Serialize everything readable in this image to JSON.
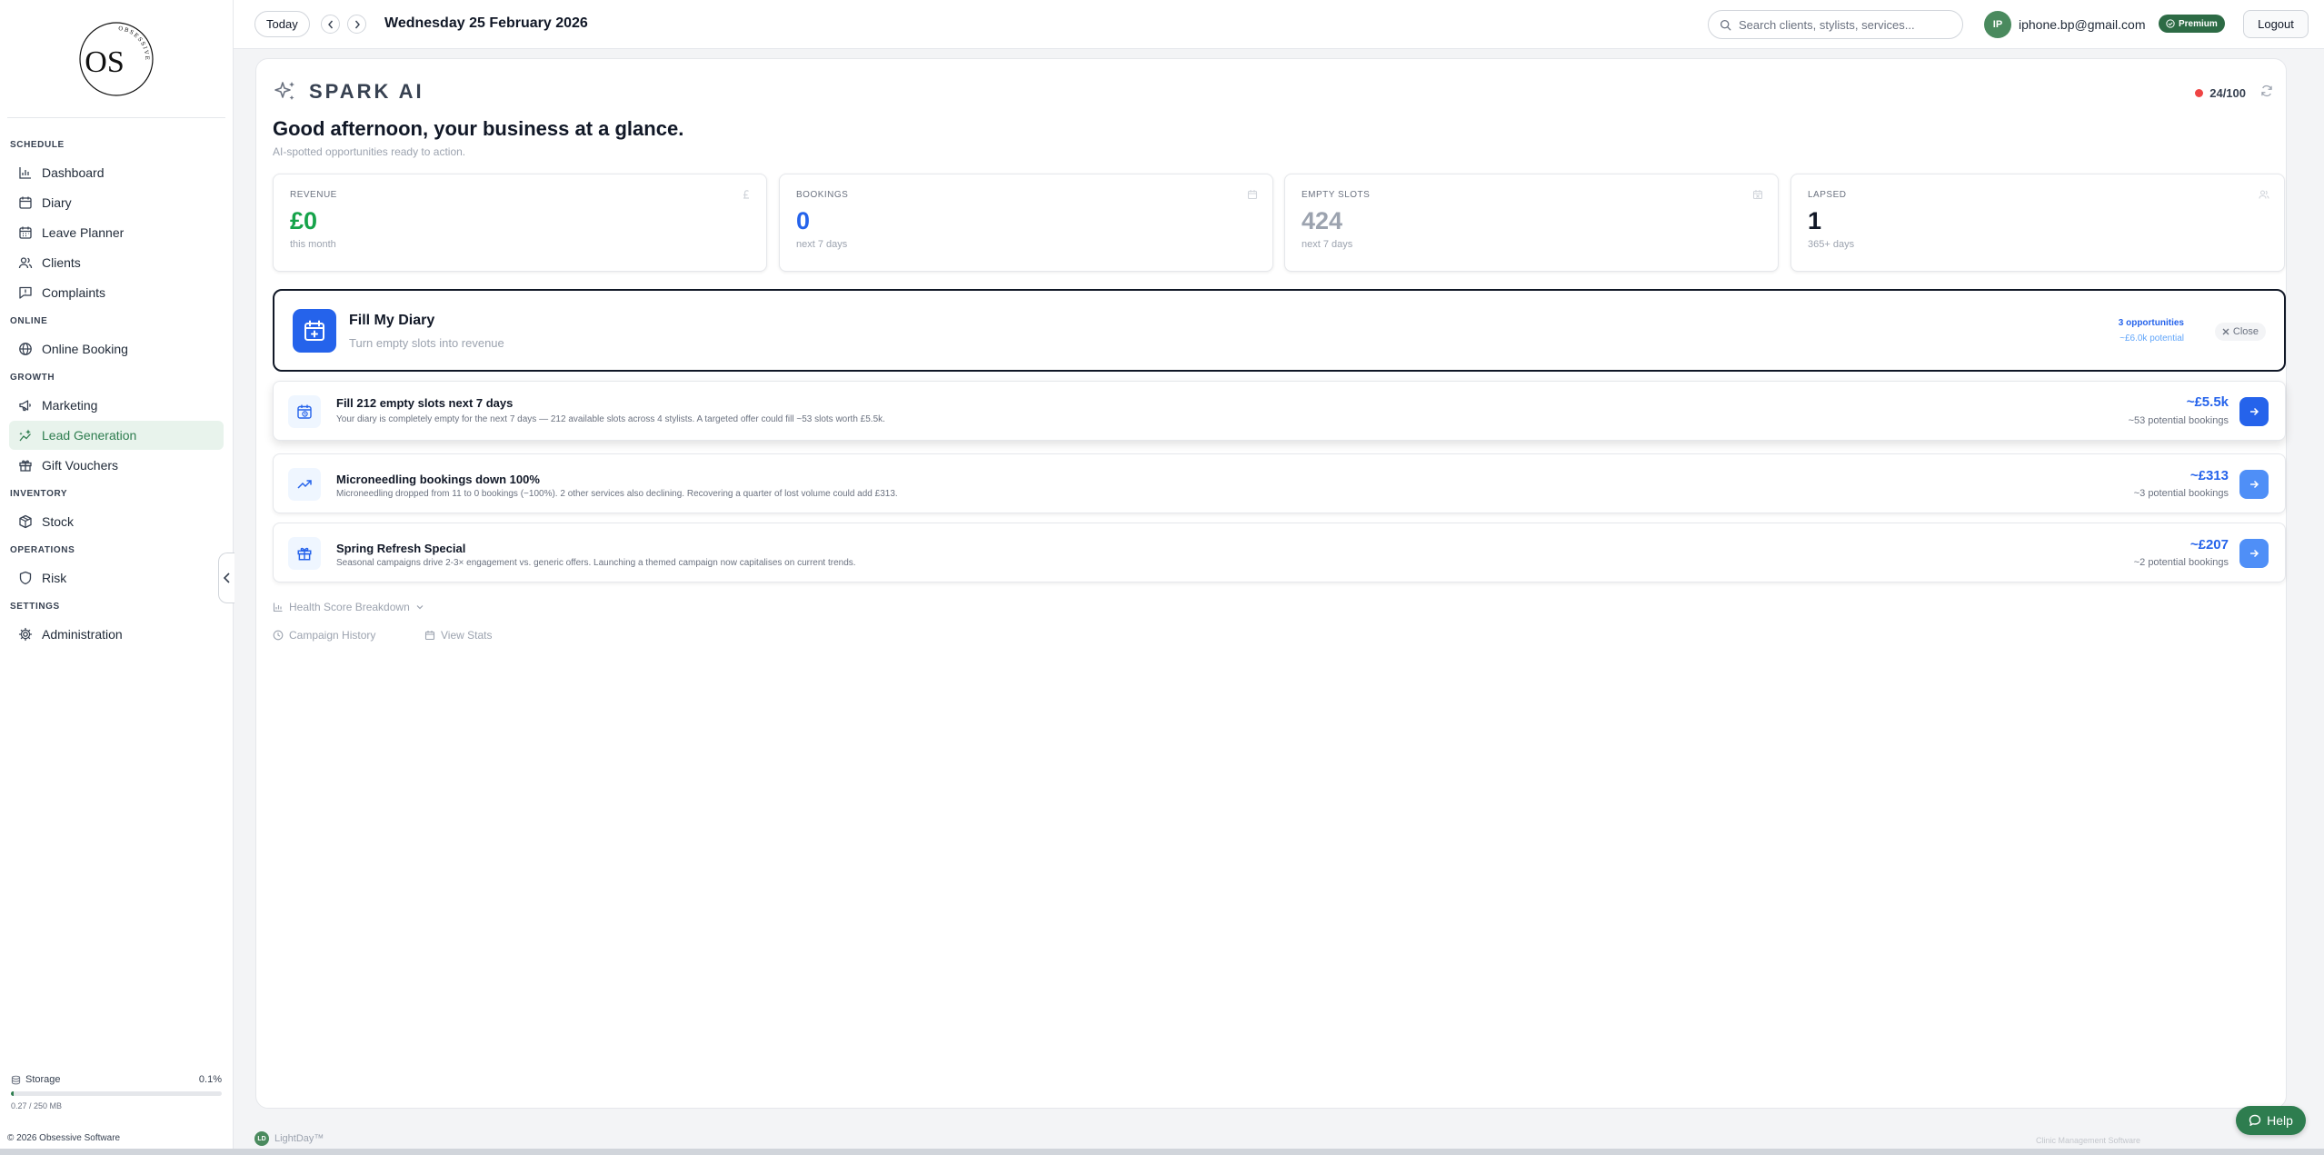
{
  "brand": {
    "logo_text": "OS",
    "logo_ring_text": "OBSESSIVE"
  },
  "sidebar": {
    "sections": [
      {
        "title": "SCHEDULE",
        "items": [
          {
            "label": "Dashboard",
            "icon": "bar-chart-icon"
          },
          {
            "label": "Diary",
            "icon": "calendar-icon"
          },
          {
            "label": "Leave Planner",
            "icon": "calendar-grid-icon"
          },
          {
            "label": "Clients",
            "icon": "users-icon"
          },
          {
            "label": "Complaints",
            "icon": "message-alert-icon"
          }
        ]
      },
      {
        "title": "ONLINE",
        "items": [
          {
            "label": "Online Booking",
            "icon": "globe-icon"
          }
        ]
      },
      {
        "title": "GROWTH",
        "items": [
          {
            "label": "Marketing",
            "icon": "megaphone-icon"
          },
          {
            "label": "Lead Generation",
            "icon": "sparkle-chart-icon",
            "active": true
          },
          {
            "label": "Gift Vouchers",
            "icon": "gift-icon"
          }
        ]
      },
      {
        "title": "INVENTORY",
        "items": [
          {
            "label": "Stock",
            "icon": "box-icon"
          }
        ]
      },
      {
        "title": "OPERATIONS",
        "items": [
          {
            "label": "Risk",
            "icon": "shield-icon"
          }
        ]
      },
      {
        "title": "SETTINGS",
        "items": [
          {
            "label": "Administration",
            "icon": "gear-icon"
          }
        ]
      }
    ],
    "storage": {
      "label": "Storage",
      "percent": "0.1%",
      "fraction": 0.001,
      "usage": "0.27 / 250 MB"
    },
    "copyright": "© 2026 Obsessive Software"
  },
  "topbar": {
    "today_label": "Today",
    "date": "Wednesday 25 February 2026",
    "search_placeholder": "Search clients, stylists, services...",
    "avatar_initials": "IP",
    "email": "iphone.bp@gmail.com",
    "plan": "Premium",
    "logout_label": "Logout"
  },
  "spark": {
    "title": "SPARK AI",
    "health_score": "24/100",
    "greeting": "Good afternoon, your business at a glance.",
    "subtitle": "AI-spotted opportunities ready to action."
  },
  "stats": [
    {
      "label": "REVENUE",
      "value": "£0",
      "sub": "this month",
      "color": "#16a34a",
      "icon": "pound-icon"
    },
    {
      "label": "BOOKINGS",
      "value": "0",
      "sub": "next 7 days",
      "color": "#2563eb",
      "icon": "calendar-icon"
    },
    {
      "label": "EMPTY SLOTS",
      "value": "424",
      "sub": "next 7 days",
      "color": "#9ca3af",
      "icon": "calendar-x-icon"
    },
    {
      "label": "LAPSED",
      "value": "1",
      "sub": "365+ days",
      "color": "#111827",
      "icon": "users-icon"
    }
  ],
  "fill_panel": {
    "title": "Fill My Diary",
    "subtitle": "Turn empty slots into revenue",
    "opportunities": "3 opportunities",
    "potential": "~£6.0k potential",
    "close_label": "Close"
  },
  "opportunities": [
    {
      "title": "Fill 212 empty slots next 7 days",
      "desc": "Your diary is completely empty for the next 7 days — 212 available slots across 4 stylists. A targeted offer could fill ~53 slots worth £5.5k.",
      "value": "~£5.5k",
      "sub": "~53 potential bookings",
      "icon": "calendar-clock-icon"
    },
    {
      "title": "Microneedling bookings down 100%",
      "desc": "Microneedling dropped from 11 to 0 bookings (−100%). 2 other services also declining. Recovering a quarter of lost volume could add £313.",
      "value": "~£313",
      "sub": "~3 potential bookings",
      "icon": "trending-up-icon"
    },
    {
      "title": "Spring Refresh Special",
      "desc": "Seasonal campaigns drive 2-3× engagement vs. generic offers. Launching a themed campaign now capitalises on current trends.",
      "value": "~£207",
      "sub": "~2 potential bookings",
      "icon": "gift-icon"
    }
  ],
  "links": {
    "health_breakdown": "Health Score Breakdown",
    "campaign_history": "Campaign History",
    "view_stats": "View Stats"
  },
  "footer": {
    "brand_logo": "LD",
    "brand": "LightDay™",
    "tagline": "Clinic Management Software",
    "help_label": "Help"
  }
}
